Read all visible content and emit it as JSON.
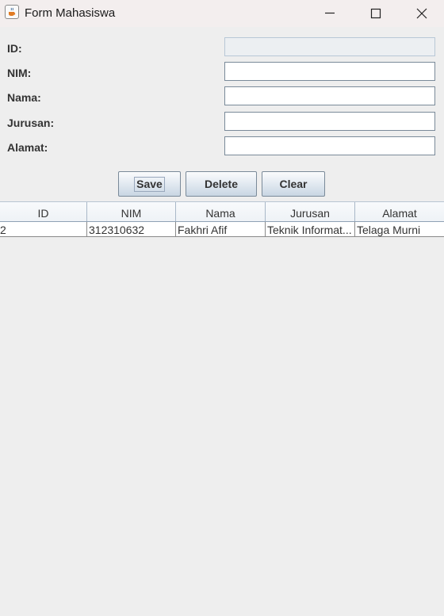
{
  "window": {
    "title": "Form Mahasiswa",
    "icon": "java-cup-icon"
  },
  "form": {
    "fields": [
      {
        "label": "ID:",
        "value": "",
        "enabled": false
      },
      {
        "label": "NIM:",
        "value": "",
        "enabled": true
      },
      {
        "label": "Nama:",
        "value": "",
        "enabled": true
      },
      {
        "label": "Jurusan:",
        "value": "",
        "enabled": true
      },
      {
        "label": "Alamat:",
        "value": "",
        "enabled": true
      }
    ]
  },
  "buttons": {
    "save": "Save",
    "delete": "Delete",
    "clear": "Clear"
  },
  "table": {
    "headers": [
      "ID",
      "NIM",
      "Nama",
      "Jurusan",
      "Alamat"
    ],
    "rows": [
      [
        "2",
        "312310632",
        "Fakhri Afif",
        "Teknik Informat...",
        "Telaga Murni"
      ]
    ]
  }
}
